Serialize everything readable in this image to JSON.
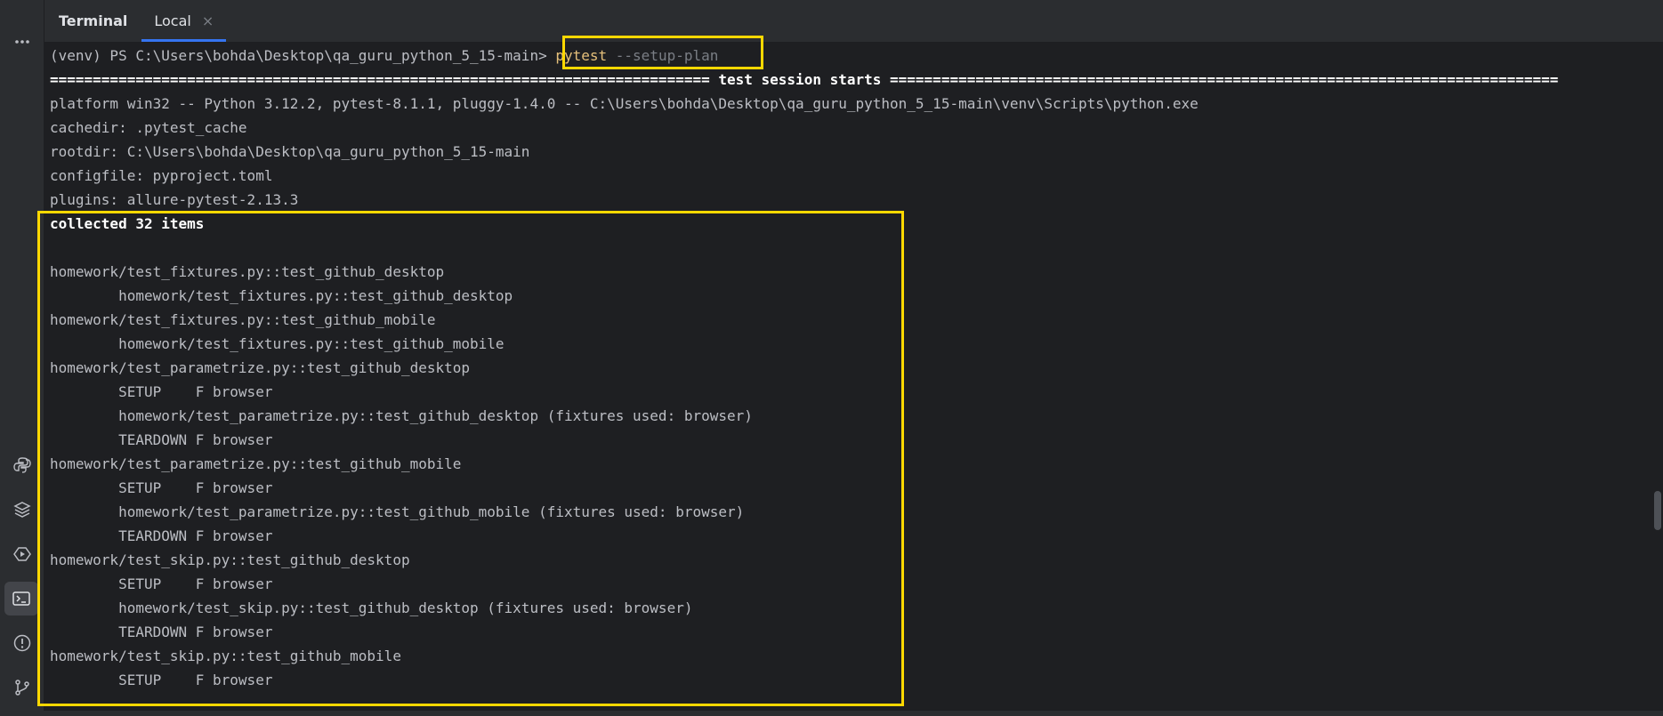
{
  "header": {
    "title": "Terminal",
    "tabs": [
      {
        "label": "Local",
        "close": "×"
      }
    ]
  },
  "toolbar": {
    "icons": [
      "grid-icon",
      "more-icon",
      "python-icon",
      "layers-icon",
      "services-icon",
      "terminal-icon",
      "problems-icon",
      "git-icon"
    ]
  },
  "terminal": {
    "prompt": "(venv) PS C:\\Users\\bohda\\Desktop\\qa_guru_python_5_15-main>",
    "command": "pytest",
    "command_args": "--setup-plan",
    "lines": [
      "============================================================================= test session starts ==============================================================================",
      "platform win32 -- Python 3.12.2, pytest-8.1.1, pluggy-1.4.0 -- C:\\Users\\bohda\\Desktop\\qa_guru_python_5_15-main\\venv\\Scripts\\python.exe",
      "cachedir: .pytest_cache",
      "rootdir: C:\\Users\\bohda\\Desktop\\qa_guru_python_5_15-main",
      "configfile: pyproject.toml",
      "plugins: allure-pytest-2.13.3",
      "collected 32 items",
      "",
      "homework/test_fixtures.py::test_github_desktop",
      "        homework/test_fixtures.py::test_github_desktop",
      "homework/test_fixtures.py::test_github_mobile",
      "        homework/test_fixtures.py::test_github_mobile",
      "homework/test_parametrize.py::test_github_desktop",
      "        SETUP    F browser",
      "        homework/test_parametrize.py::test_github_desktop (fixtures used: browser)",
      "        TEARDOWN F browser",
      "homework/test_parametrize.py::test_github_mobile",
      "        SETUP    F browser",
      "        homework/test_parametrize.py::test_github_mobile (fixtures used: browser)",
      "        TEARDOWN F browser",
      "homework/test_skip.py::test_github_desktop",
      "        SETUP    F browser",
      "        homework/test_skip.py::test_github_desktop (fixtures used: browser)",
      "        TEARDOWN F browser",
      "homework/test_skip.py::test_github_mobile",
      "        SETUP    F browser"
    ]
  },
  "colors": {
    "highlight": "#ffd800",
    "command": "#e5c07b",
    "background": "#1e1f22"
  }
}
